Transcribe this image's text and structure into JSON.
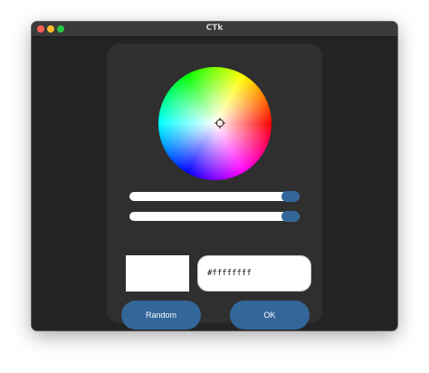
{
  "window": {
    "title": "CTk"
  },
  "color_picker": {
    "hex_value": "#ffffffff",
    "preview_color": "#ffffff",
    "brightness_slider_value": 1.0,
    "opacity_slider_value": 1.0,
    "random_label": "Random",
    "ok_label": "OK"
  },
  "colors": {
    "accent": "#336699",
    "window_bg": "#242424",
    "panel_bg": "#2f2f2f",
    "slider_track": "#ffffff"
  },
  "icons": {
    "wheel_reticle": "crosshair-icon"
  }
}
